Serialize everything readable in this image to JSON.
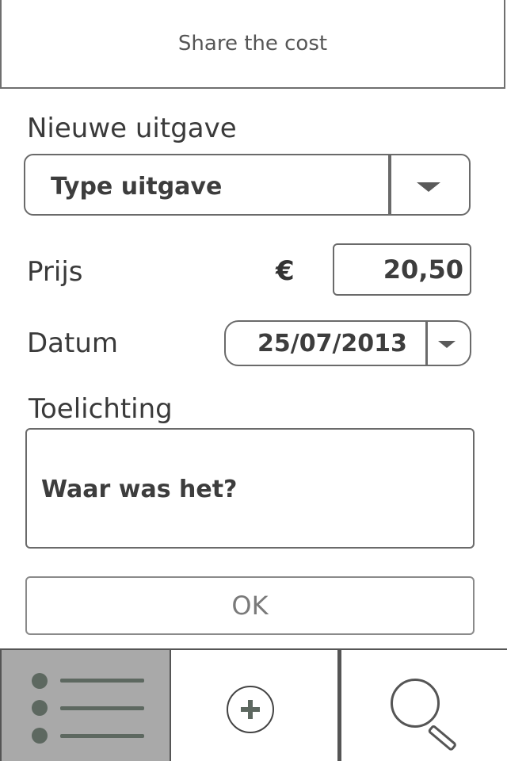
{
  "header": {
    "title": "Share the cost"
  },
  "form": {
    "heading": "Nieuwe uitgave",
    "type_select": {
      "value": "Type uitgave"
    },
    "price": {
      "label": "Prijs",
      "currency": "€",
      "value": "20,50"
    },
    "date": {
      "label": "Datum",
      "value": "25/07/2013"
    },
    "note": {
      "label": "Toelichting",
      "placeholder": "Waar was het?"
    },
    "ok_label": "OK"
  },
  "tabbar": {
    "tabs": [
      {
        "icon": "list-icon",
        "active": true
      },
      {
        "icon": "add-icon",
        "active": false
      },
      {
        "icon": "search-icon",
        "active": false
      }
    ]
  }
}
